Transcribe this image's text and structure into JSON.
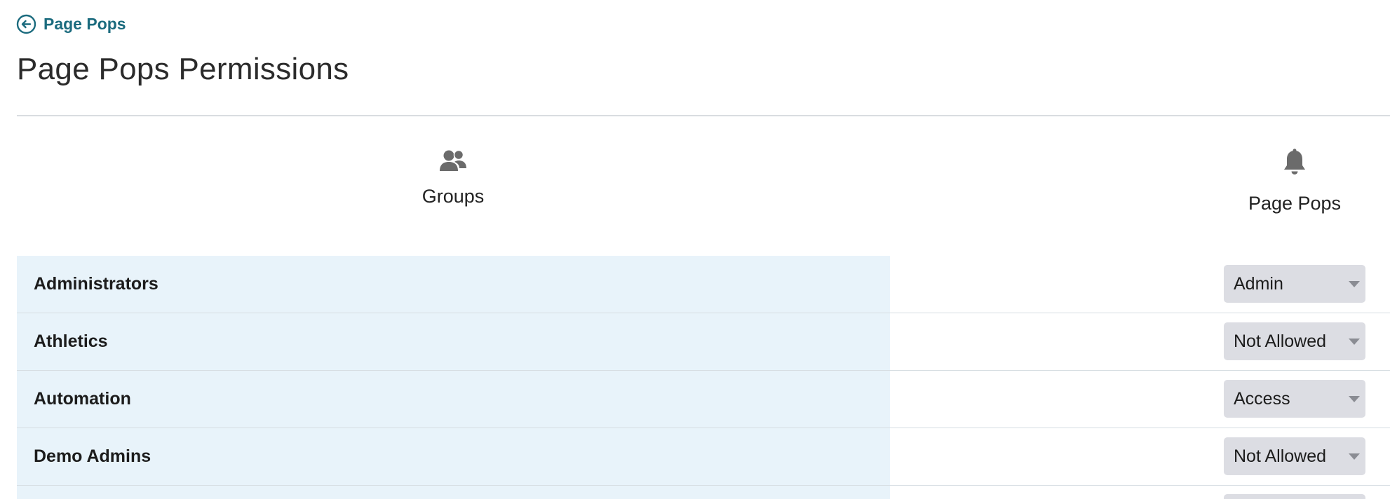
{
  "back_link": {
    "label": "Page Pops",
    "icon": "arrow-left-circle-icon"
  },
  "page_title": "Page Pops Permissions",
  "columns": {
    "groups": {
      "label": "Groups",
      "icon": "users-icon"
    },
    "page_pops": {
      "label": "Page Pops",
      "icon": "bell-icon"
    }
  },
  "rows": [
    {
      "name": "Administrators",
      "permission": "Admin"
    },
    {
      "name": "Athletics",
      "permission": "Not Allowed"
    },
    {
      "name": "Automation",
      "permission": "Access"
    },
    {
      "name": "Demo Admins",
      "permission": "Not Allowed"
    }
  ],
  "colors": {
    "accent": "#1b6b7e",
    "row_highlight": "#e8f3fa",
    "select_bg": "#dcdde3",
    "icon_gray": "#6b6b6b"
  }
}
